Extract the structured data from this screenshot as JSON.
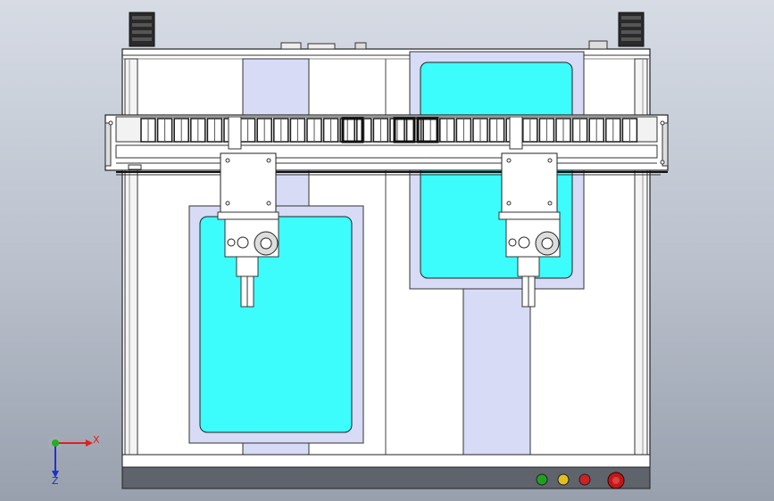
{
  "viewport": {
    "background_top": "#d6dbe4",
    "background_bottom": "#98a0ad"
  },
  "colors": {
    "frame": "#ffffff",
    "frame_stroke": "#222222",
    "glass_cyan": "#3dfcfc",
    "pad_lavender": "#d7dbf6",
    "base_dark": "#5f636b",
    "chain_black": "#1a1a1a"
  },
  "triad": {
    "x_label": "X",
    "y_label": "Y",
    "z_label": "Z",
    "x_color": "#e02020",
    "y_color": "#20b020",
    "z_color": "#2030d0"
  },
  "indicator_lights": [
    {
      "name": "green-light",
      "color": "#20a020"
    },
    {
      "name": "yellow-light",
      "color": "#e0c020"
    },
    {
      "name": "red-light",
      "color": "#d02020"
    }
  ],
  "emergency_stop": {
    "color": "#c01818"
  }
}
